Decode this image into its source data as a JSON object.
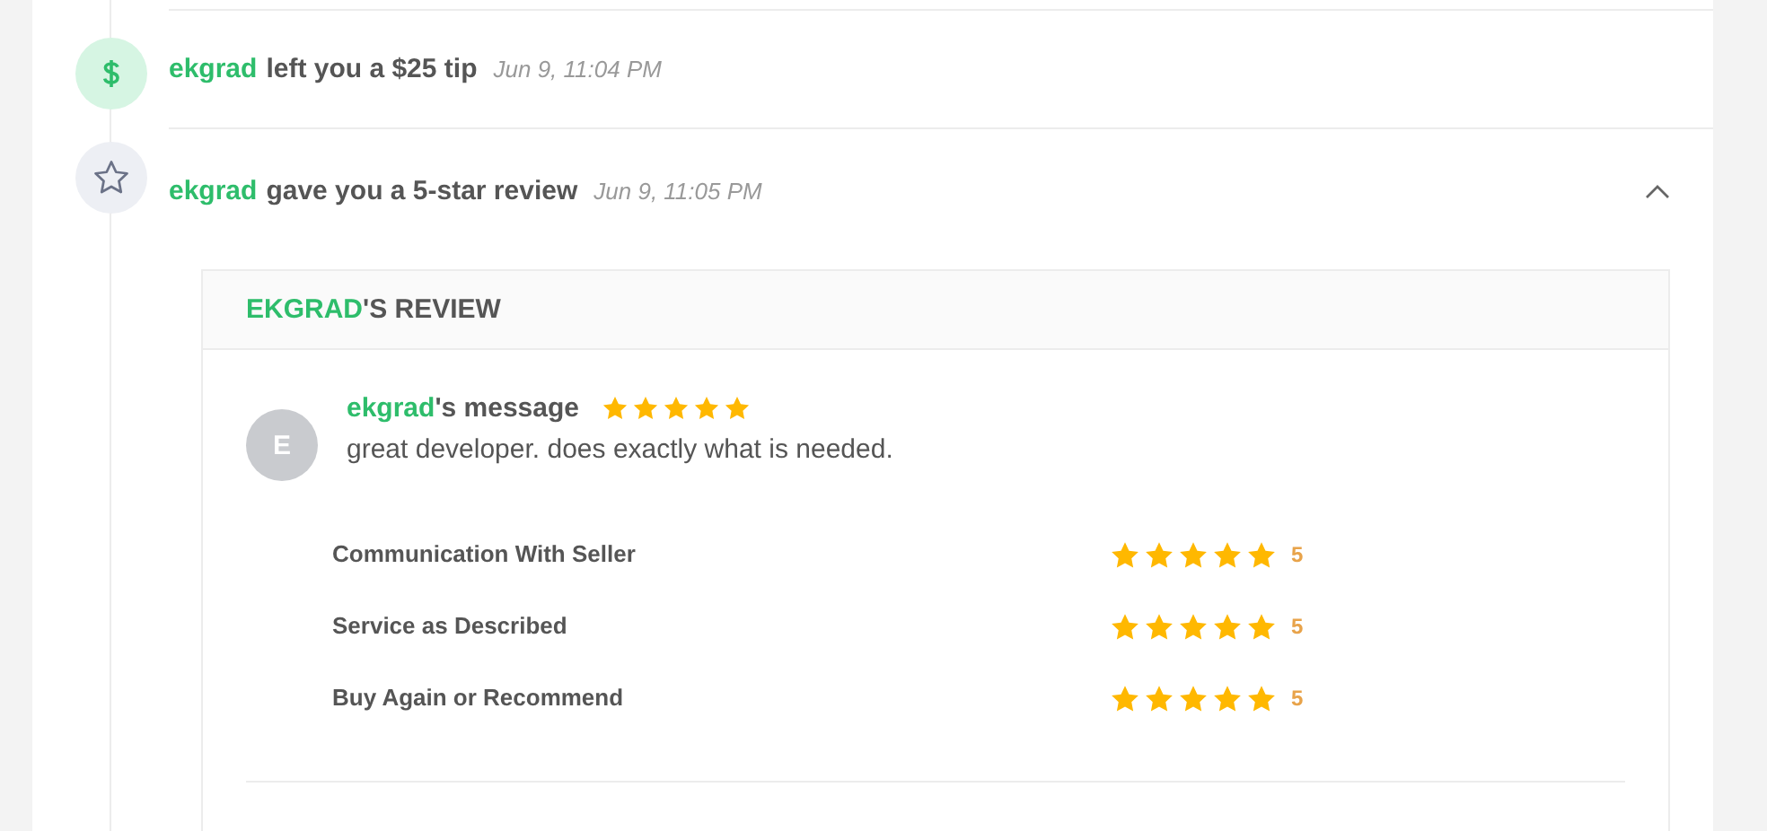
{
  "events": [
    {
      "kind": "tip",
      "actor": "ekgrad",
      "text": "left you a $25 tip",
      "time": "Jun 9, 11:04 PM"
    },
    {
      "kind": "review",
      "actor": "ekgrad",
      "text": "gave you a 5-star review",
      "time": "Jun 9, 11:05 PM",
      "expanded": true
    }
  ],
  "review": {
    "title_name": "EKGRAD",
    "title_suffix": "'S REVIEW",
    "avatar": "E",
    "author": "ekgrad",
    "author_suffix": "'s message",
    "stars": 5,
    "message": "great developer. does exactly what is needed.",
    "ratings": [
      {
        "label": "Communication With Seller",
        "stars": 5,
        "score": "5"
      },
      {
        "label": "Service as Described",
        "stars": 5,
        "score": "5"
      },
      {
        "label": "Buy Again or Recommend",
        "stars": 5,
        "score": "5"
      }
    ]
  }
}
